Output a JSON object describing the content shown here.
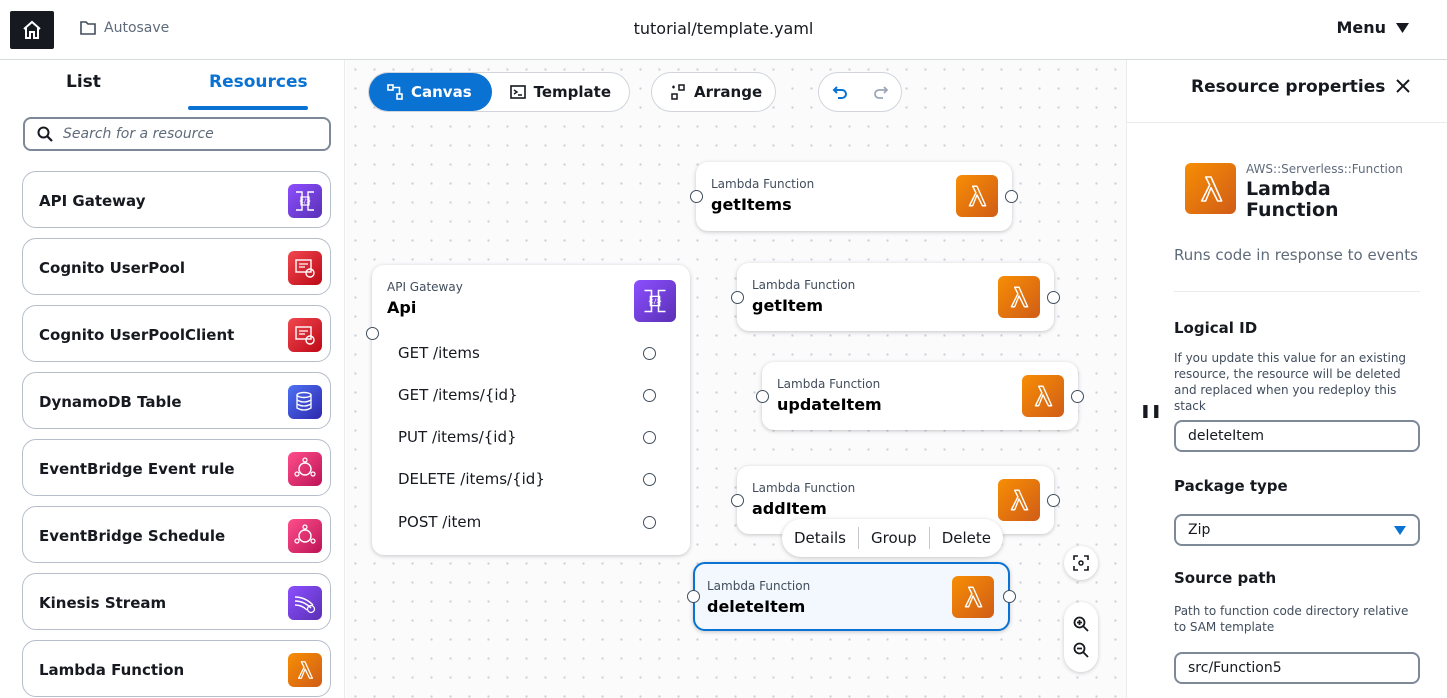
{
  "header": {
    "autosave_label": "Autosave",
    "file_title": "tutorial/template.yaml",
    "menu_label": "Menu"
  },
  "left_panel": {
    "tabs": [
      {
        "label": "List"
      },
      {
        "label": "Resources"
      }
    ],
    "active_tab": "Resources",
    "search_placeholder": "Search for a resource",
    "resources": [
      {
        "label": "API Gateway",
        "icon": "api-gateway-icon",
        "color": "#7b3fe4"
      },
      {
        "label": "Cognito UserPool",
        "icon": "cognito-icon",
        "color": "#d6242d"
      },
      {
        "label": "Cognito UserPoolClient",
        "icon": "cognito-icon",
        "color": "#d6242d"
      },
      {
        "label": "DynamoDB Table",
        "icon": "dynamodb-icon",
        "color": "#3b48cc"
      },
      {
        "label": "EventBridge Event rule",
        "icon": "eventbridge-icon",
        "color": "#d81b60"
      },
      {
        "label": "EventBridge Schedule",
        "icon": "eventbridge-icon",
        "color": "#d81b60"
      },
      {
        "label": "Kinesis Stream",
        "icon": "kinesis-icon",
        "color": "#7b3fe4"
      },
      {
        "label": "Lambda Function",
        "icon": "lambda-icon",
        "color": "#e7700d"
      }
    ]
  },
  "toolbar": {
    "canvas_label": "Canvas",
    "template_label": "Template",
    "arrange_label": "Arrange"
  },
  "canvas": {
    "api_node": {
      "type": "API Gateway",
      "name": "Api",
      "routes": [
        "GET /items",
        "GET /items/{id}",
        "PUT /items/{id}",
        "DELETE /items/{id}",
        "POST /item"
      ]
    },
    "lambda_nodes": [
      {
        "type": "Lambda Function",
        "name": "getItems"
      },
      {
        "type": "Lambda Function",
        "name": "getItem"
      },
      {
        "type": "Lambda Function",
        "name": "updateItem"
      },
      {
        "type": "Lambda Function",
        "name": "addItem"
      },
      {
        "type": "Lambda Function",
        "name": "deleteItem",
        "selected": true
      }
    ],
    "context_menu": {
      "details": "Details",
      "group": "Group",
      "delete": "Delete"
    }
  },
  "properties": {
    "title": "Resource properties",
    "resource_type": "AWS::Serverless::Function",
    "resource_name": "Lambda Function",
    "description": "Runs code in response to events",
    "logical_id_label": "Logical ID",
    "logical_id_help": "If you update this value for an existing resource, the resource will be deleted and replaced when you redeploy this stack",
    "logical_id_value": "deleteItem",
    "package_type_label": "Package type",
    "package_type_value": "Zip",
    "source_path_label": "Source path",
    "source_path_help": "Path to function code directory relative to SAM template",
    "source_path_value": "src/Function5"
  },
  "colors": {
    "accent": "#0972d3",
    "lambda": "#e7700d",
    "api_gateway": "#7b3fe4"
  }
}
